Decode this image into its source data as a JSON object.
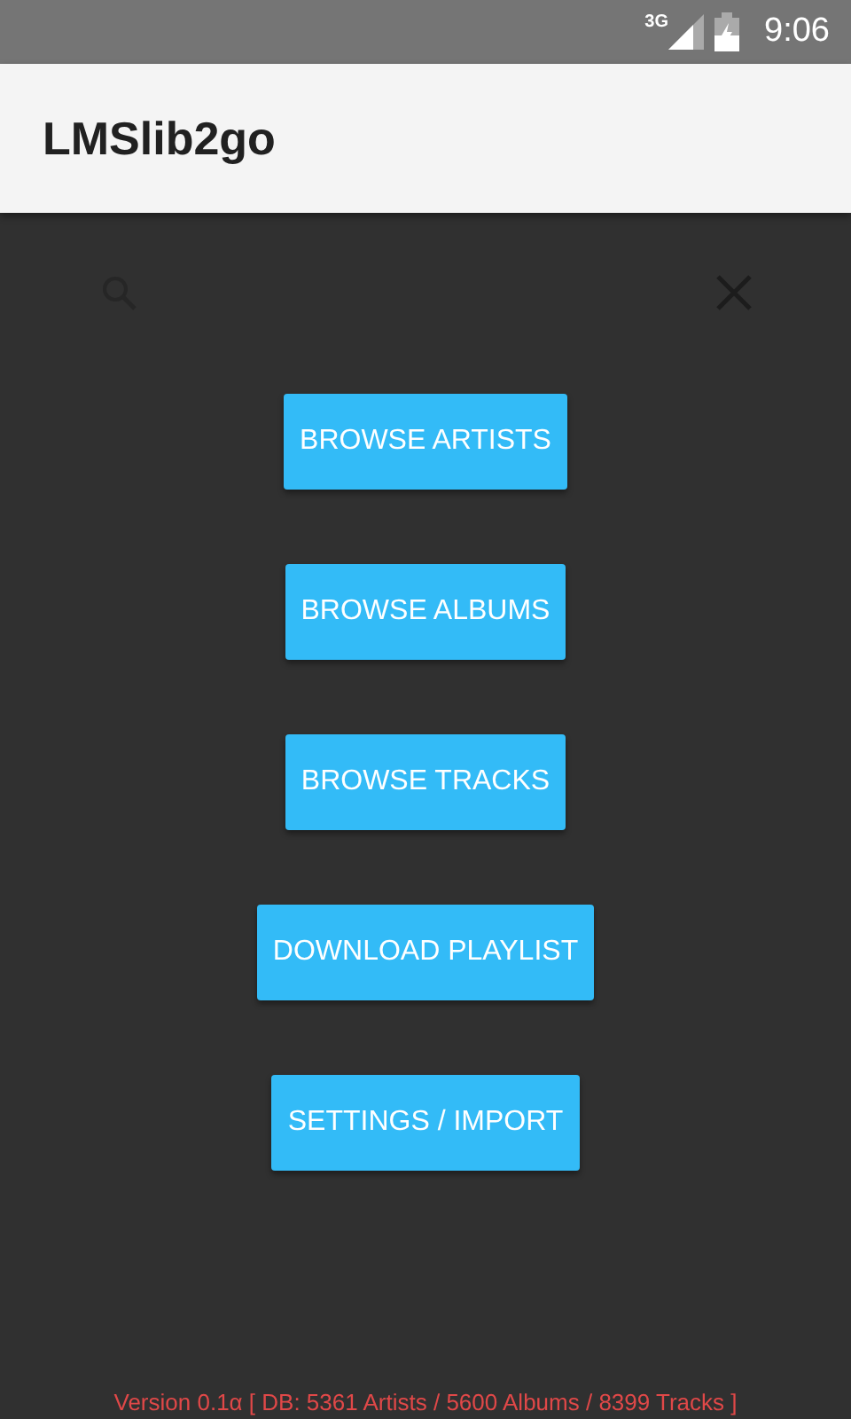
{
  "status_bar": {
    "network": "3G",
    "time": "9:06"
  },
  "app_bar": {
    "title": "LMSlib2go"
  },
  "buttons": [
    "BROWSE ARTISTS",
    "BROWSE ALBUMS",
    "BROWSE TRACKS",
    "DOWNLOAD PLAYLIST",
    "SETTINGS / IMPORT"
  ],
  "footer": "Version 0.1α [ DB: 5361 Artists / 5600 Albums / 8399 Tracks ]"
}
